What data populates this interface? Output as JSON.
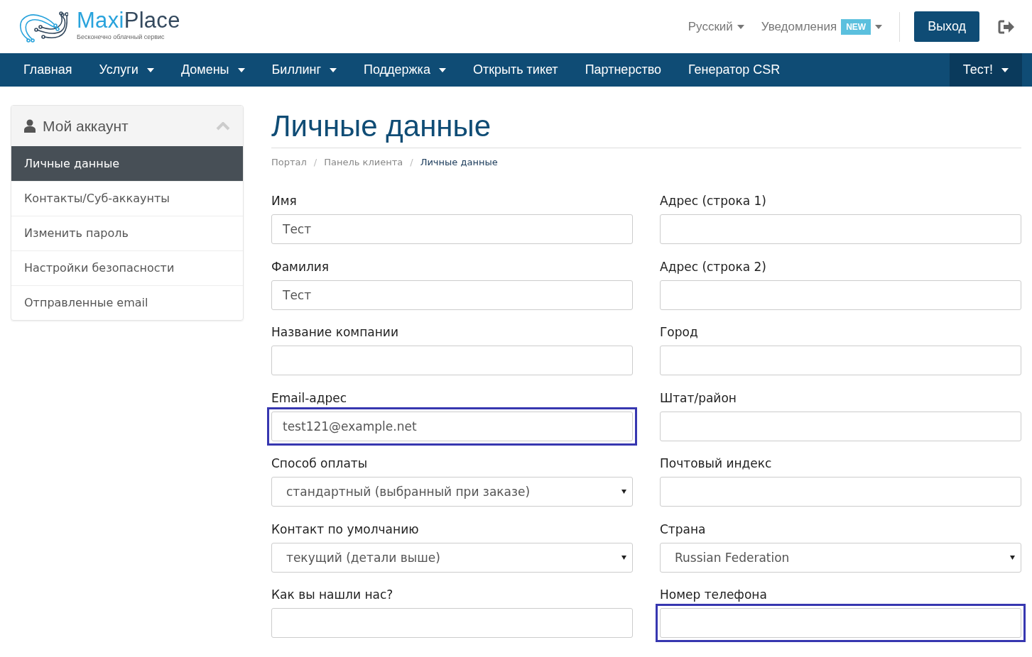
{
  "logo": {
    "name_start": "Maxi",
    "name_end": "Place",
    "tagline": "Бесконечно облачный сервис"
  },
  "top_links": [
    {
      "label": "Русский"
    },
    {
      "label": "Уведомления",
      "badge": "NEW"
    }
  ],
  "logout_button": "Выход",
  "nav": {
    "items": [
      {
        "label": "Главная",
        "caret": false
      },
      {
        "label": "Услуги",
        "caret": true
      },
      {
        "label": "Домены",
        "caret": true
      },
      {
        "label": "Биллинг",
        "caret": true
      },
      {
        "label": "Поддержка",
        "caret": true
      },
      {
        "label": "Открыть тикет",
        "caret": false
      },
      {
        "label": "Партнерство",
        "caret": false
      },
      {
        "label": "Генератор CSR",
        "caret": false
      }
    ],
    "user": {
      "label": "Тест!",
      "caret": true
    }
  },
  "sidebar": {
    "title": "Мой аккаунт",
    "expanded": true,
    "items": [
      {
        "label": "Личные данные",
        "selected": true
      },
      {
        "label": "Контакты/Суб-аккаунты",
        "selected": false
      },
      {
        "label": "Изменить пароль",
        "selected": false
      },
      {
        "label": "Настройки безопасности",
        "selected": false
      },
      {
        "label": "Отправленные email",
        "selected": false
      }
    ]
  },
  "page_title": "Личные данные",
  "breadcrumb": {
    "separator": "/",
    "items": [
      {
        "label": "Портал",
        "current": false
      },
      {
        "label": "Панель клиента",
        "current": false
      },
      {
        "label": "Личные данные",
        "current": true
      }
    ]
  },
  "form": {
    "columns": [
      [
        {
          "label": "Имя",
          "kind": "input",
          "value": "Тест",
          "highlighted": false
        },
        {
          "label": "Фамилия",
          "kind": "input",
          "value": "Тест",
          "highlighted": false
        },
        {
          "label": "Название компании",
          "kind": "input",
          "highlighted": false
        },
        {
          "label": "Email-адрес",
          "kind": "input",
          "value": "test121@example.net",
          "highlighted": true
        },
        {
          "label": "Способ оплаты",
          "kind": "select",
          "value": "стандартный (выбранный при заказе)",
          "highlighted": false
        },
        {
          "label": "Контакт по умолчанию",
          "kind": "select",
          "value": "текущий (детали выше)",
          "highlighted": false
        },
        {
          "label": "Как вы нашли нас?",
          "kind": "input",
          "highlighted": false
        }
      ],
      [
        {
          "label": "Адрес (строка 1)",
          "kind": "input",
          "highlighted": false
        },
        {
          "label": "Адрес (строка 2)",
          "kind": "input",
          "highlighted": false
        },
        {
          "label": "Город",
          "kind": "input",
          "highlighted": false
        },
        {
          "label": "Штат/район",
          "kind": "input",
          "highlighted": false
        },
        {
          "label": "Почтовый индекс",
          "kind": "input",
          "highlighted": false
        },
        {
          "label": "Страна",
          "kind": "select",
          "value": "Russian Federation",
          "highlighted": false
        },
        {
          "label": "Номер телефона",
          "kind": "input",
          "highlighted": true
        }
      ]
    ]
  }
}
